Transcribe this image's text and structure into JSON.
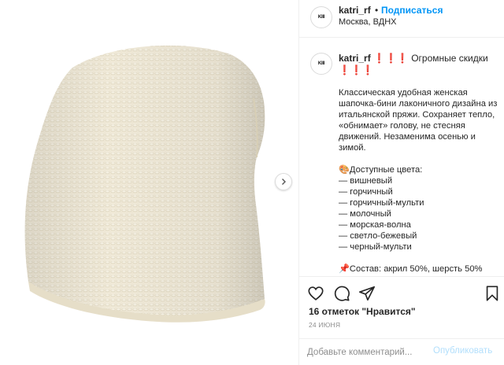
{
  "header": {
    "username": "katri_rf",
    "separator": "•",
    "follow_label": "Подписаться",
    "location": "Москва, ВДНХ",
    "avatar_text": "KIII"
  },
  "caption": {
    "username": "katri_rf",
    "headline_emoji_1": "❗❗❗",
    "headline_text": " Огромные скидки ",
    "headline_emoji_2": "❗❗❗",
    "body": "Классическая удобная женская шапочка-бини лаконичного дизайна из итальянской пряжи. Сохраняет тепло, «обнимает» голову, не стесняя движений. Незаменима осенью и зимой.\n\n🎨Доступные цвета:\n— вишневый\n— горчичный\n— горчичный-мульти\n— молочный\n— морская-волна\n— светло-бежевый\n— черный-мульти\n\n📌Состав: акрил 50%, шерсть 50%"
  },
  "actions": {
    "likes": "16 отметок \"Нравится\"",
    "date": "24 ИЮНЯ",
    "comment_placeholder": "Добавьте комментарий...",
    "publish_label": "Опубликовать",
    "icons": [
      "heart-icon",
      "comment-icon",
      "share-icon",
      "bookmark-icon",
      "chevron-right-icon"
    ]
  },
  "colors": {
    "accent": "#0095f6",
    "publish_disabled": "#b2dffc",
    "emoji_red": "#e0245e",
    "hat": "#efe9d8"
  }
}
